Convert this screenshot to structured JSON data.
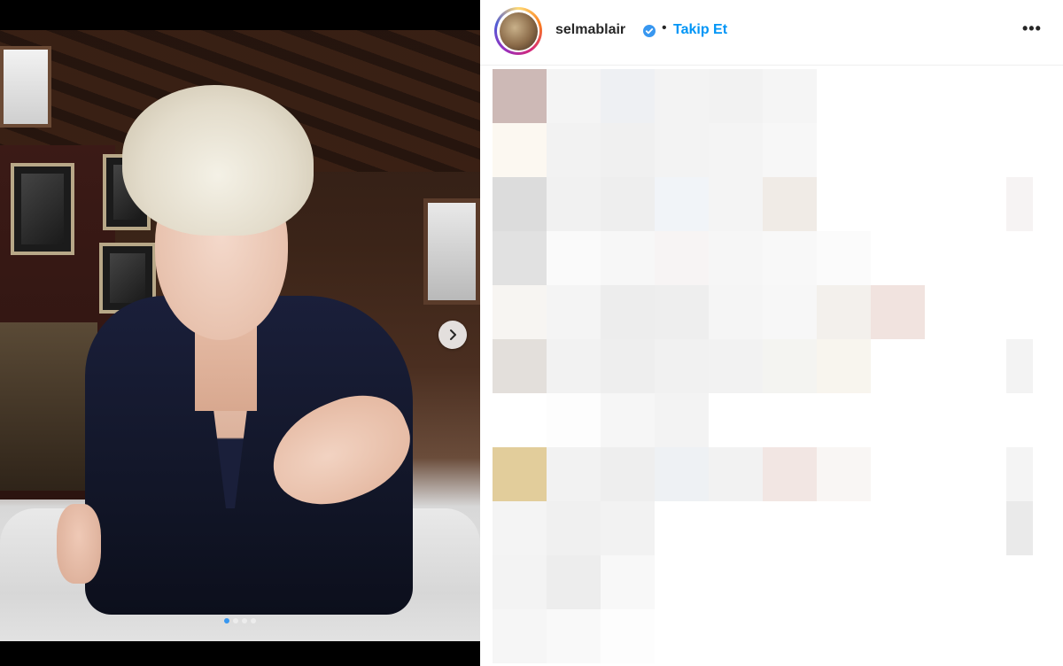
{
  "post": {
    "username": "selmablair",
    "separator": "•",
    "follow_label": "Takip Et",
    "more_label": "•••",
    "carousel": {
      "total": 4,
      "active_index": 0
    }
  },
  "icons": {
    "verified": "verified-badge-icon",
    "next": "chevron-right-icon",
    "more": "more-options-icon"
  },
  "colors": {
    "accent": "#0095f6",
    "verified": "#3897f0",
    "text": "#262626"
  }
}
